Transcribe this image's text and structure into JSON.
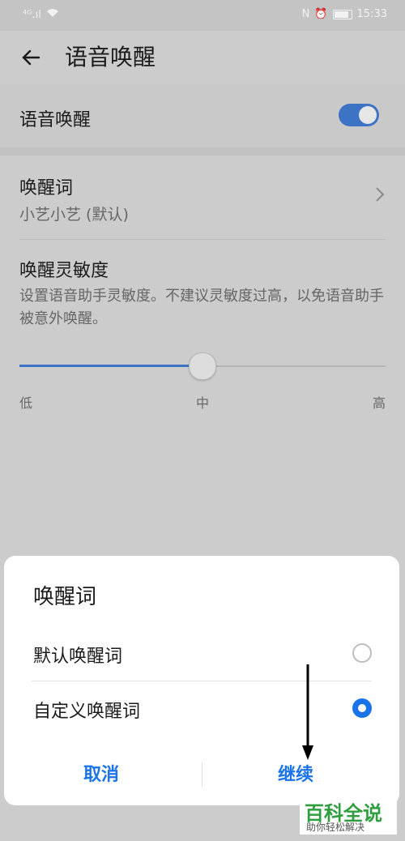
{
  "status_bar": {
    "left_signal": "⁴ᴳ.ıl",
    "wifi": "wifi-icon",
    "right_nfc": "N",
    "right_alarm": "⏰",
    "time": "15:33"
  },
  "app_bar": {
    "title": "语音唤醒"
  },
  "settings": {
    "voice_wake_label": "语音唤醒",
    "voice_wake_enabled": true,
    "wake_word_title": "唤醒词",
    "wake_word_value": "小艺小艺 (默认)",
    "sensitivity_title": "唤醒灵敏度",
    "sensitivity_desc": "设置语音助手灵敏度。不建议灵敏度过高，以免语音助手被意外唤醒。",
    "sensitivity_level": 0.5,
    "slider_labels": {
      "low": "低",
      "mid": "中",
      "high": "高"
    }
  },
  "dialog": {
    "title": "唤醒词",
    "options": [
      {
        "label": "默认唤醒词",
        "selected": false
      },
      {
        "label": "自定义唤醒词",
        "selected": true
      }
    ],
    "cancel_label": "取消",
    "continue_label": "继续"
  },
  "watermark": {
    "main": "百科全说",
    "sub": "助你轻松解决"
  },
  "colors": {
    "accent": "#1a73e8",
    "toggle_on": "#3d73c4",
    "watermark_green": "#2e9e3f"
  }
}
